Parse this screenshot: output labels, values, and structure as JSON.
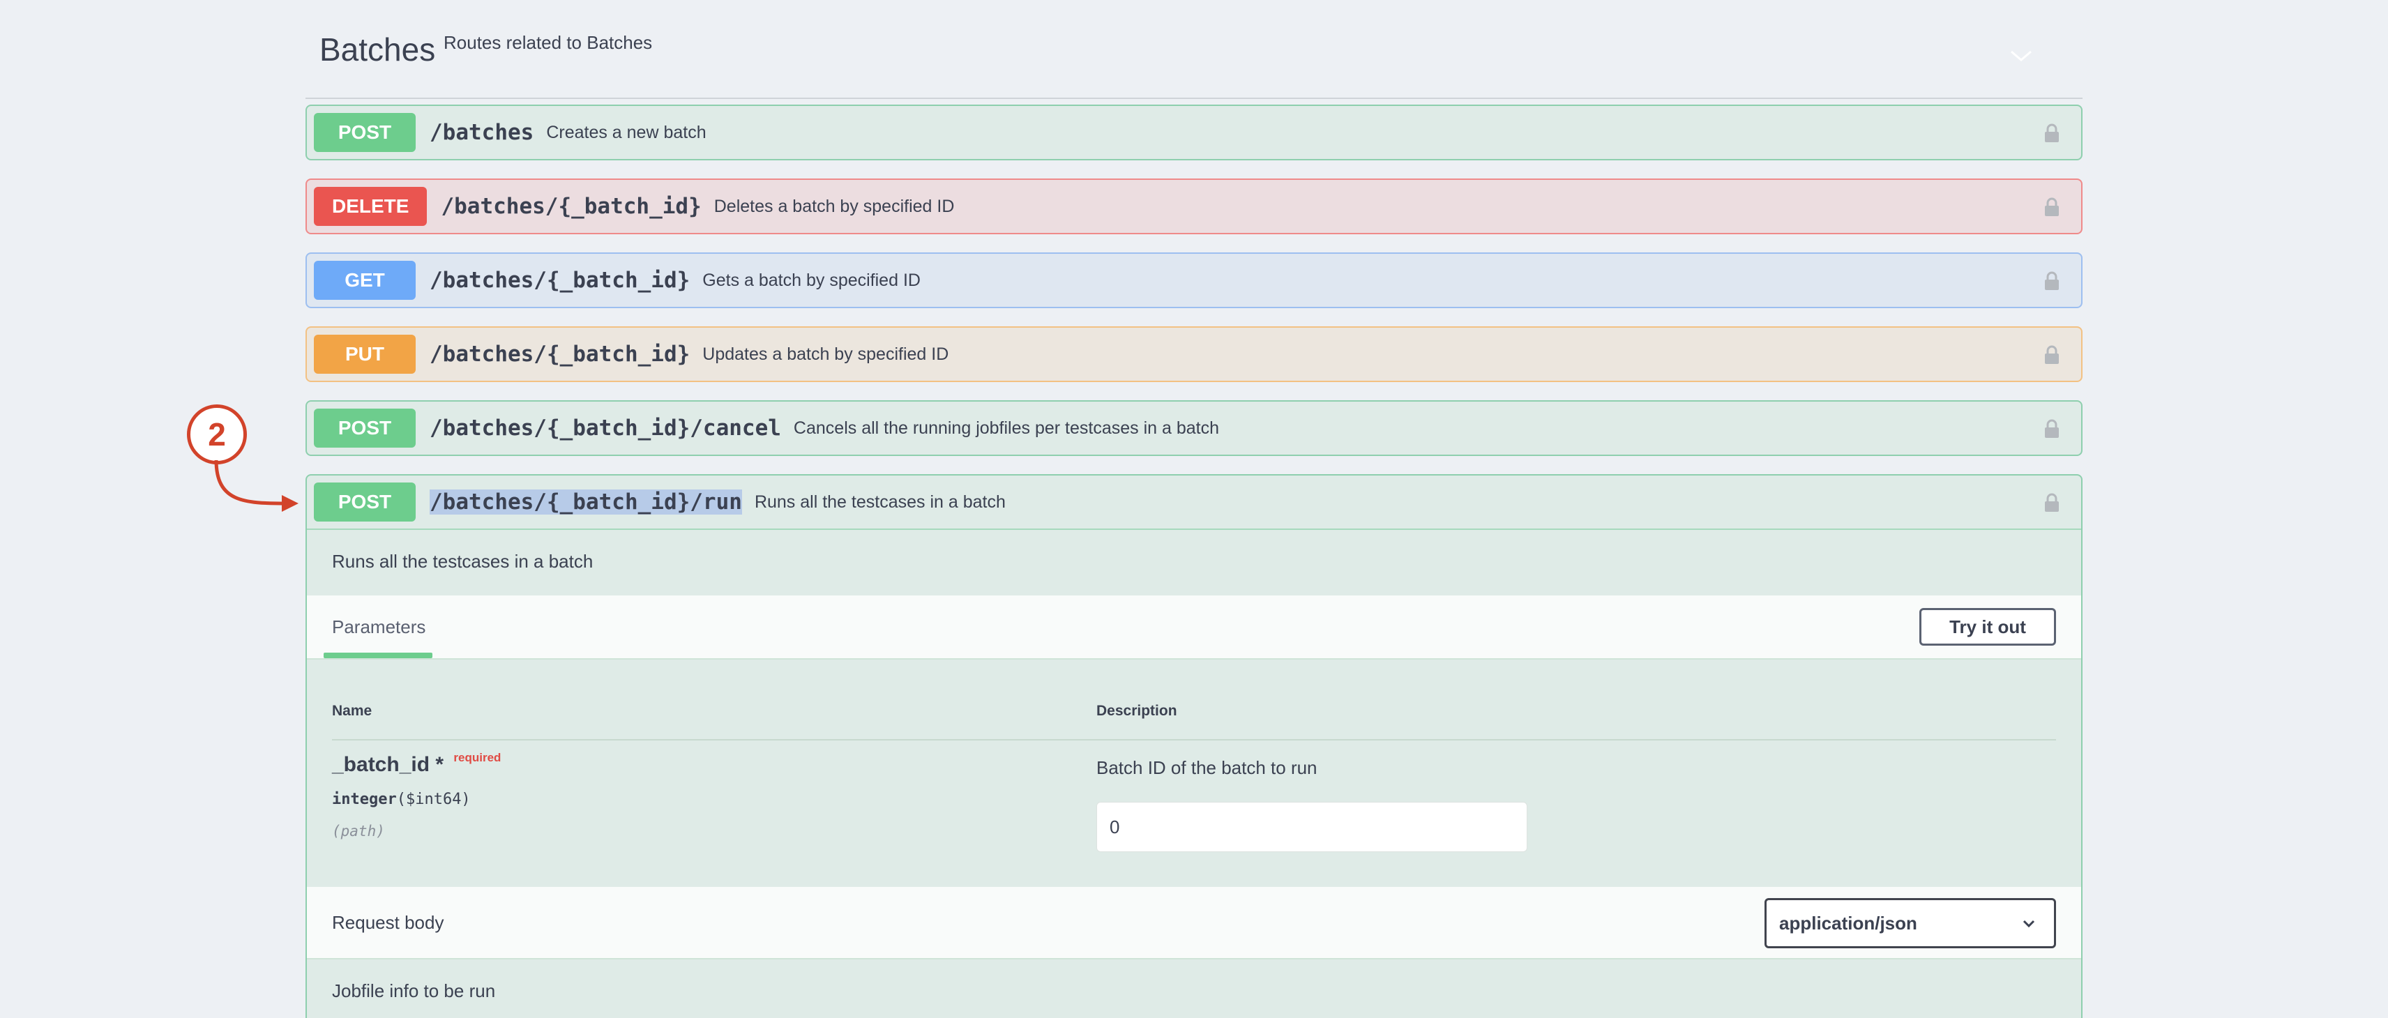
{
  "tag": {
    "title": "Batches",
    "description": "Routes related to Batches"
  },
  "operations": [
    {
      "method": "POST",
      "path": "/batches",
      "summary": "Creates a new batch"
    },
    {
      "method": "DELETE",
      "path": "/batches/{_batch_id}",
      "summary": "Deletes a batch by specified ID"
    },
    {
      "method": "GET",
      "path": "/batches/{_batch_id}",
      "summary": "Gets a batch by specified ID"
    },
    {
      "method": "PUT",
      "path": "/batches/{_batch_id}",
      "summary": "Updates a batch by specified ID"
    },
    {
      "method": "POST",
      "path": "/batches/{_batch_id}/cancel",
      "summary": "Cancels all the running jobfiles per testcases in a batch"
    },
    {
      "method": "POST",
      "path": "/batches/{_batch_id}/run",
      "summary": "Runs all the testcases in a batch"
    }
  ],
  "expanded": {
    "description": "Runs all the testcases in a batch",
    "tab_label": "Parameters",
    "try_button": "Try it out",
    "columns": {
      "name": "Name",
      "description": "Description"
    },
    "param": {
      "name": "_batch_id",
      "star": "*",
      "required": "required",
      "type": "integer",
      "format": "($int64)",
      "in": "(path)",
      "description": "Batch ID of the batch to run",
      "value": "0"
    },
    "request_body": {
      "title": "Request body",
      "content_type": "application/json",
      "description": "Jobfile info to be run"
    }
  },
  "annotation": {
    "number": "2",
    "color": "#d2432a"
  }
}
